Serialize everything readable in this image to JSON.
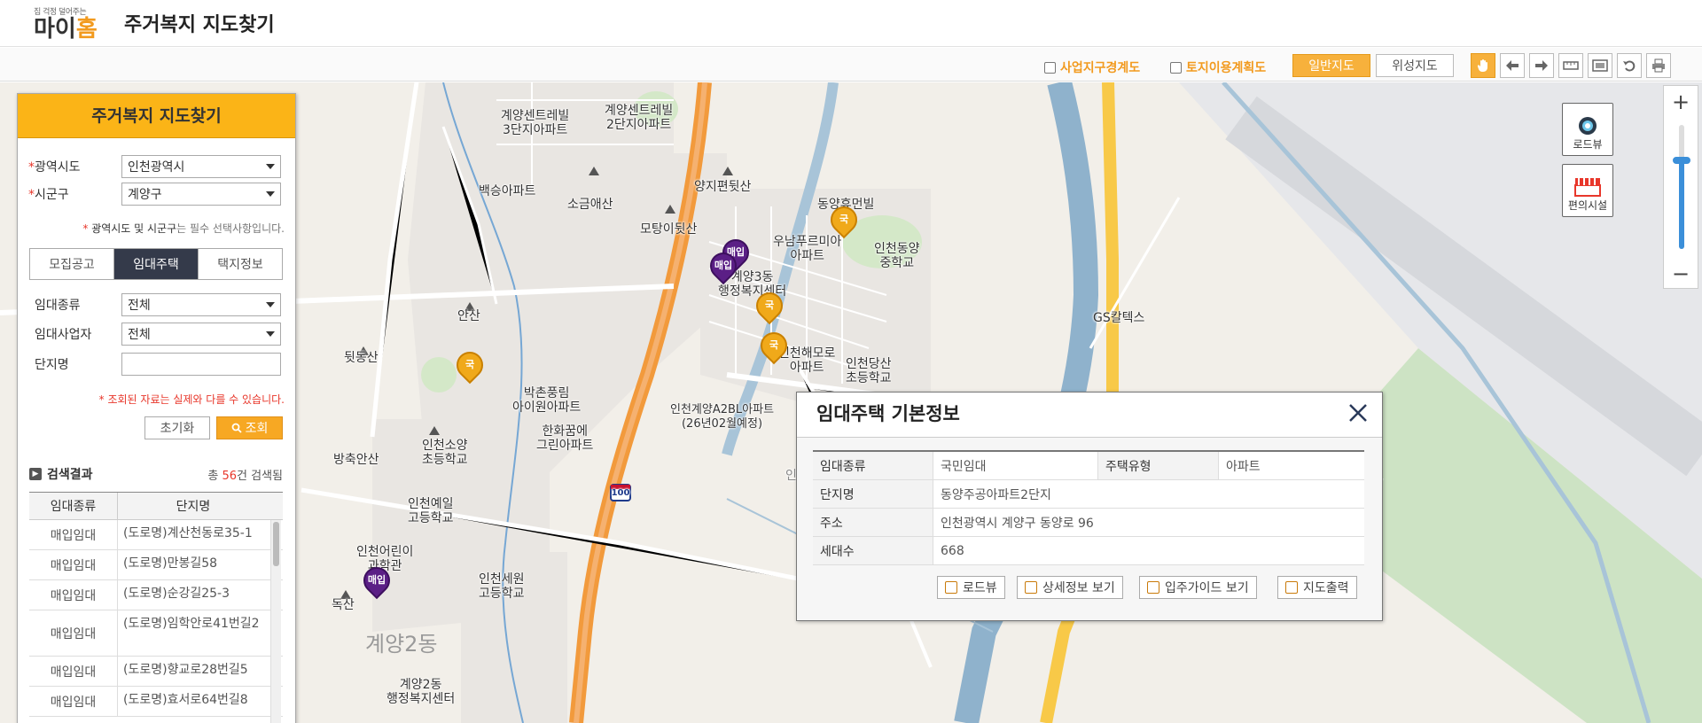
{
  "header": {
    "logo_tagline": "집 걱정 덜어주는",
    "logo_text_a": "마이",
    "logo_text_b": "홈",
    "title": "주거복지 지도찾기"
  },
  "toolbar": {
    "checkbox_project_boundary": "사업지구경계도",
    "checkbox_land_use_plan": "토지이용계획도",
    "map_normal": "일반지도",
    "map_satellite": "위성지도",
    "tools": [
      "hand-icon",
      "arrow-left-icon",
      "arrow-right-icon",
      "measure-distance-icon",
      "measure-area-icon",
      "undo-icon",
      "print-icon"
    ]
  },
  "panel": {
    "title": "주거복지 지도찾기",
    "region_label": "광역시도",
    "region_value": "인천광역시",
    "district_label": "시군구",
    "district_value": "계양구",
    "required_note_a": "광역시도 및 시군구",
    "required_note_b": "는 필수 선택사항입니다.",
    "tabs": [
      "모집공고",
      "임대주택",
      "택지정보"
    ],
    "rental_type_label": "임대종류",
    "rental_type_value": "전체",
    "rental_operator_label": "임대사업자",
    "rental_operator_value": "전체",
    "complex_name_label": "단지명",
    "disclaimer": "조회된 자료는 실제와 다를 수 있습니다.",
    "reset_button": "초기화",
    "search_button": "조회",
    "results_label": "검색결과",
    "results_count_prefix": "총",
    "results_count": "56",
    "results_count_suffix": "건 검색됨",
    "table_headers": [
      "임대종류",
      "단지명"
    ],
    "rows": [
      {
        "type": "매입임대",
        "name": "(도로명)계산천동로35-1"
      },
      {
        "type": "매입임대",
        "name": "(도로명)만봉길58"
      },
      {
        "type": "매입임대",
        "name": "(도로명)순강길25-3"
      },
      {
        "type": "매입임대",
        "name": "(도로명)임학안로41번길2"
      },
      {
        "type": "매입임대",
        "name": "(도로명)향교로28번길5"
      },
      {
        "type": "매입임대",
        "name": "(도로명)효서로64번길8"
      }
    ]
  },
  "popup": {
    "title": "임대주택 기본정보",
    "rental_type_label": "임대종류",
    "rental_type_value": "국민임대",
    "housing_type_label": "주택유형",
    "housing_type_value": "아파트",
    "complex_label": "단지명",
    "complex_value": "동양주공아파트2단지",
    "address_label": "주소",
    "address_value": "인천광역시 계양구 동양로 96",
    "households_label": "세대수",
    "households_value": "668",
    "btn_roadview": "로드뷰",
    "btn_detail": "상세정보 보기",
    "btn_guide": "입주가이드 보기",
    "btn_print": "지도출력"
  },
  "map_controls": {
    "roadview": "로드뷰",
    "facilities": "편의시설",
    "zoom_in": "+",
    "zoom_out": "−"
  },
  "map_labels": {
    "gyeyang_central_3": "계양센트레빌\n3단지아파트",
    "gyeyang_central_2": "계양센트레빌\n2단지아파트",
    "baekseung": "백승아파트",
    "sogeumaesan": "소금애산",
    "yangjipyeon": "양지편뒷산",
    "motang": "모탕이뒷산",
    "dongyang_humanville": "동양휴먼빌",
    "unamprimia": "우남푸르미아\n아파트",
    "incheon_dongyang_mid": "인천동양\n중학교",
    "gyeyang3dong_center": "계양3동\n행정복지센터",
    "ansan": "안산",
    "dwitdongsan": "뒷동산",
    "incheon_haemaro": "인천해모로\n아파트",
    "incheon_dangsan_elem": "인천당산\n초등학교",
    "gs_caltex": "GS칼텍스",
    "bakchon_pungrim": "박촌풍림\n아이원아파트",
    "hanhwa_kkumui": "한화꿈에\n그린아파트",
    "incheon_gyeyang_a2bl": "인천계양A2BL아파트\n(26년02월예정)",
    "incheon_sosang_elem": "인천소양\n초등학교",
    "bangchukansan": "방축안산",
    "incheon_yeil_high": "인천예일\n고등학교",
    "incheon_children_sci": "인천어린이\n과학관",
    "dokssan": "독산",
    "incheon_sewon_high": "인천세원\n고등학교",
    "gyeyang2dong": "계양2동",
    "gyeyang2dong_center": "계양2동\n행정복지센터",
    "gan": "인",
    "route_100": "100",
    "pin_gold": "국",
    "pin_purple": "매입",
    "pin_purple_sm": "매입"
  }
}
